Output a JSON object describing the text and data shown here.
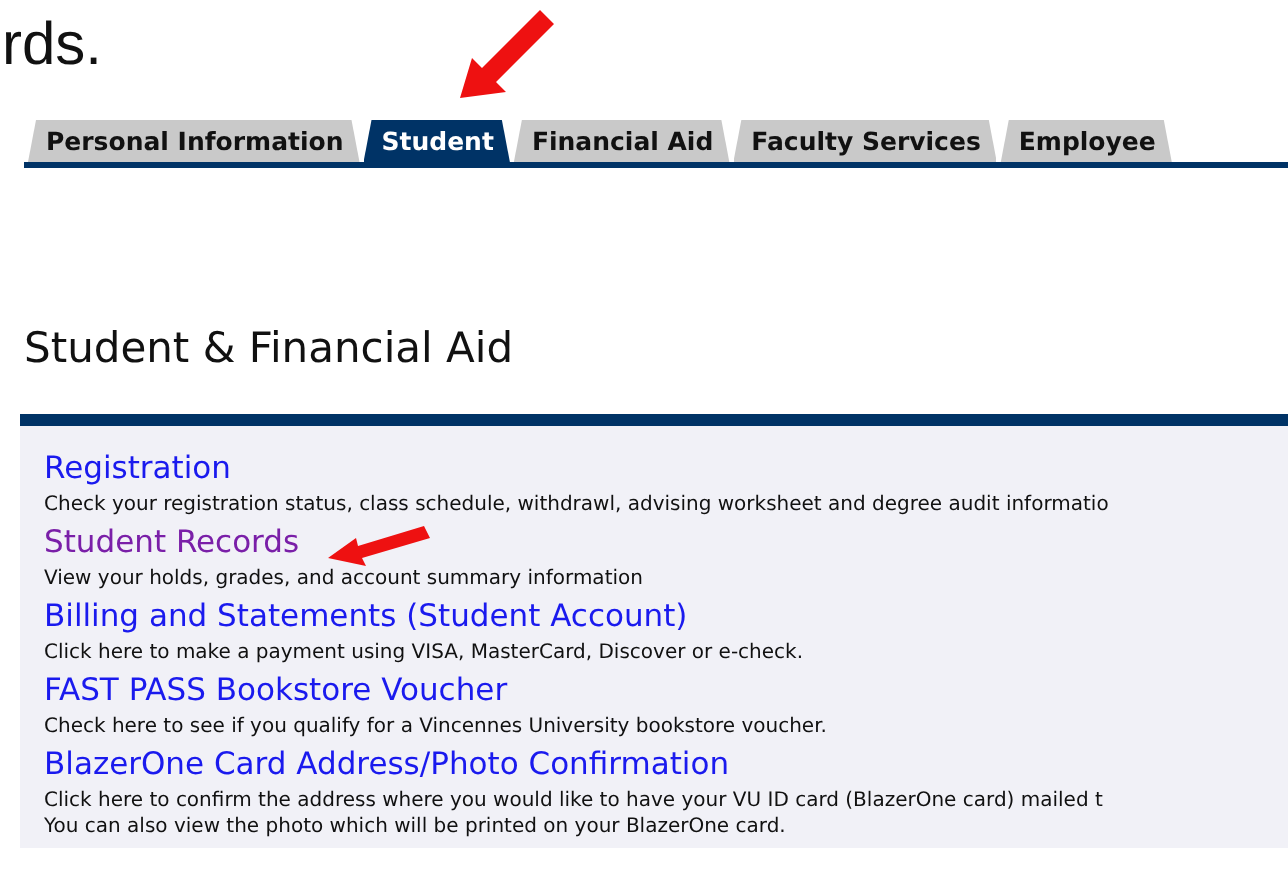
{
  "intro_fragment": "rds.",
  "tabs": [
    {
      "label": "Personal Information",
      "selected": false
    },
    {
      "label": "Student",
      "selected": true
    },
    {
      "label": "Financial Aid",
      "selected": false
    },
    {
      "label": "Faculty Services",
      "selected": false
    },
    {
      "label": "Employee",
      "selected": false
    }
  ],
  "heading": "Student & Financial Aid",
  "menu": [
    {
      "title": "Registration",
      "visited": false,
      "description": [
        "Check your registration status, class schedule, withdrawl, advising worksheet and degree audit informatio"
      ]
    },
    {
      "title": "Student Records",
      "visited": true,
      "description": [
        "View your holds, grades, and account summary information"
      ]
    },
    {
      "title": "Billing and Statements (Student Account)",
      "visited": false,
      "description": [
        "Click here to make a payment using VISA, MasterCard, Discover or e-check."
      ]
    },
    {
      "title": "FAST PASS Bookstore Voucher",
      "visited": false,
      "description": [
        "Check here to see if you qualify for a Vincennes University bookstore voucher."
      ]
    },
    {
      "title": "BlazerOne Card Address/Photo Confirmation",
      "visited": false,
      "description": [
        "Click here to confirm the address where you would like to have your VU ID card (BlazerOne card) mailed t",
        "You can also view the photo which will be printed on your BlazerOne card."
      ]
    }
  ]
}
